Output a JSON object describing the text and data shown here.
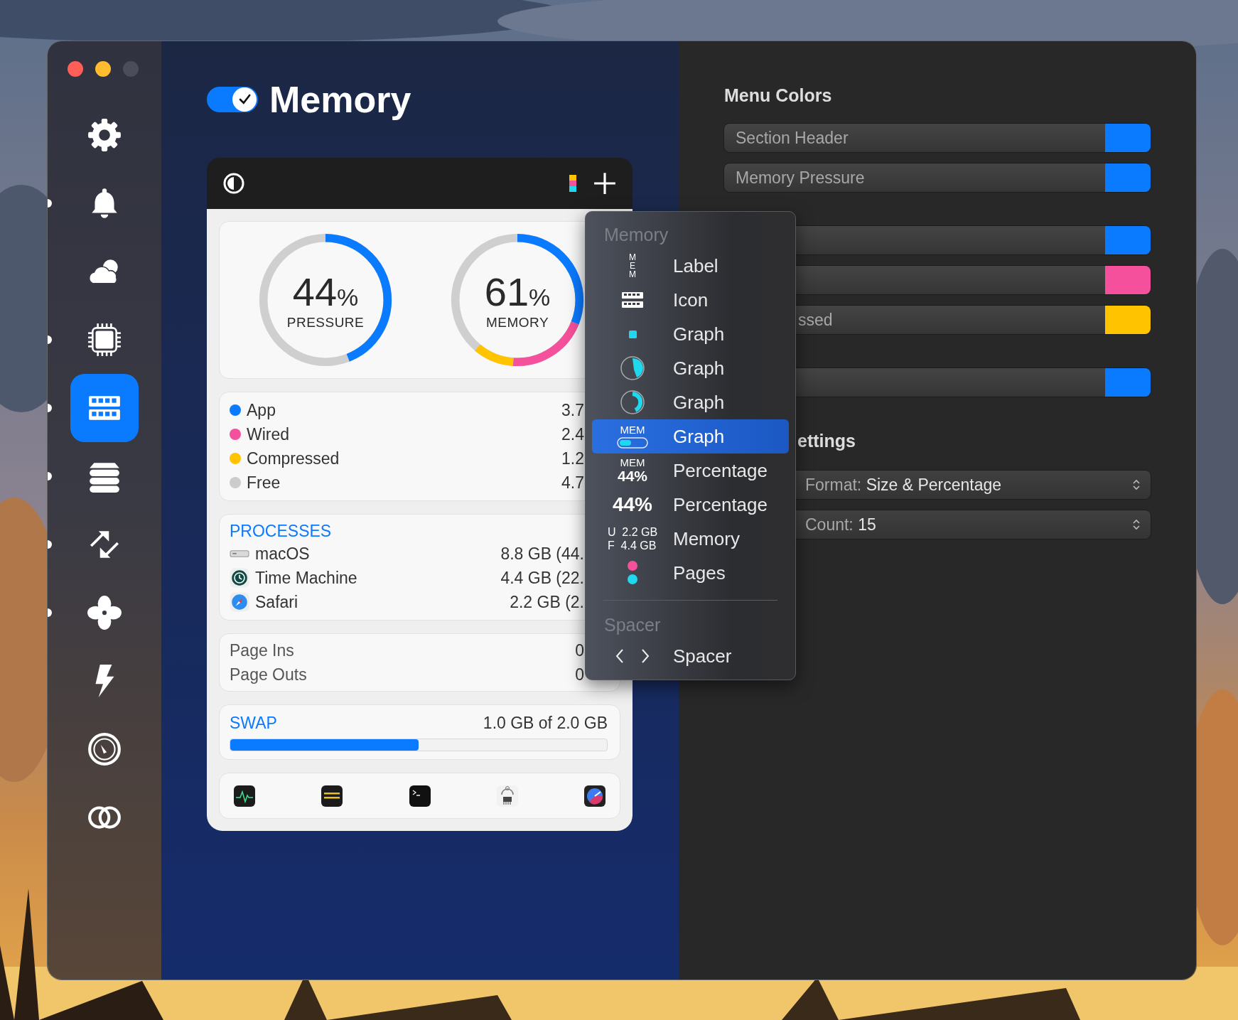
{
  "window": {
    "controls": [
      {
        "color": "#ff5f57"
      },
      {
        "color": "#febc2e"
      },
      {
        "color": "#4b4e5a"
      }
    ]
  },
  "sidebar": {
    "items": [
      {
        "kind": "gear",
        "selected": false,
        "enabled": false
      },
      {
        "kind": "bell",
        "selected": false,
        "enabled": true
      },
      {
        "kind": "cloud",
        "selected": false,
        "enabled": false
      },
      {
        "kind": "cpu",
        "selected": false,
        "enabled": true
      },
      {
        "kind": "ram",
        "selected": true,
        "enabled": true
      },
      {
        "kind": "disk",
        "selected": false,
        "enabled": true
      },
      {
        "kind": "arrows",
        "selected": false,
        "enabled": true
      },
      {
        "kind": "fan",
        "selected": false,
        "enabled": true
      },
      {
        "kind": "bolt",
        "selected": false,
        "enabled": false
      },
      {
        "kind": "clock",
        "selected": false,
        "enabled": false
      },
      {
        "kind": "rings",
        "selected": false,
        "enabled": false
      }
    ]
  },
  "header": {
    "title": "Memory",
    "on": true
  },
  "widget": {
    "gauges": [
      {
        "value": "44",
        "unit": "%",
        "caption": "PRESSURE",
        "segments": [
          {
            "color": "#0a7aff",
            "level": 0.44
          }
        ]
      },
      {
        "value": "61",
        "unit": "%",
        "caption": "MEMORY",
        "segments": [
          {
            "color": "#0a7aff",
            "level": 0.31
          },
          {
            "color": "#f5509b",
            "level": 0.2
          },
          {
            "color": "#ffc300",
            "level": 0.1
          }
        ]
      }
    ],
    "legend": [
      {
        "label": "App",
        "value": "3.7",
        "color": "#0a7aff"
      },
      {
        "label": "Wired",
        "value": "2.4",
        "color": "#f5509b"
      },
      {
        "label": "Compressed",
        "value": "1.2",
        "color": "#ffc300"
      },
      {
        "label": "Free",
        "value": "4.7",
        "color": "#cccccc"
      }
    ],
    "processes": {
      "title": "PROCESSES",
      "rows": [
        {
          "kind": "system",
          "name": "macOS",
          "value": "8.8 GB (44."
        },
        {
          "kind": "backup",
          "name": "Time Machine",
          "value": "4.4 GB (22."
        },
        {
          "kind": "browser",
          "name": "Safari",
          "value": "2.2 GB (2."
        }
      ]
    },
    "pages": [
      {
        "label": "Page Ins",
        "value": "0"
      },
      {
        "label": "Page Outs",
        "value": "0"
      }
    ],
    "swap": {
      "title": "SWAP",
      "reading": "1.0 GB of 2.0 GB",
      "level": 0.5
    },
    "apps": [
      {
        "kind": "monitor"
      },
      {
        "kind": "console"
      },
      {
        "kind": "terminal"
      },
      {
        "kind": "sysinfo"
      },
      {
        "kind": "speed"
      }
    ]
  },
  "menu": {
    "sections": [
      {
        "title": "Memory",
        "items": [
          {
            "kind": "label",
            "preview": "MEM",
            "label": "Label",
            "selected": false
          },
          {
            "kind": "icon",
            "label": "Icon",
            "selected": false
          },
          {
            "kind": "dot",
            "label": "Graph",
            "selected": false
          },
          {
            "kind": "pie",
            "label": "Graph",
            "selected": false
          },
          {
            "kind": "ring",
            "label": "Graph",
            "selected": false
          },
          {
            "kind": "bar",
            "preview": "MEM",
            "label": "Graph",
            "selected": true
          },
          {
            "kind": "stack",
            "preview_lines": [
              "MEM",
              "44%"
            ],
            "label": "Percentage",
            "selected": false
          },
          {
            "kind": "big",
            "preview": "44%",
            "label": "Percentage",
            "selected": false
          },
          {
            "kind": "memory",
            "preview_rows": [
              {
                "key": "U",
                "value": "2.2 GB"
              },
              {
                "key": "F",
                "value": "4.4 GB"
              }
            ],
            "label": "Memory",
            "selected": false
          },
          {
            "kind": "pages",
            "label": "Pages",
            "selected": false
          }
        ]
      },
      {
        "title": "Spacer",
        "items": [
          {
            "kind": "spacer",
            "label": "Spacer",
            "selected": false
          }
        ]
      }
    ]
  },
  "settings": {
    "title": "Menu Colors",
    "color_groups": [
      [
        {
          "label": "Section Header",
          "color": "#0a7aff"
        },
        {
          "label": "Memory Pressure",
          "color": "#0a7aff"
        }
      ],
      [
        {
          "color": "#0a7aff"
        },
        {
          "color": "#f5509b"
        },
        {
          "label": "ssed",
          "color": "#ffc300"
        }
      ],
      [
        {
          "color": "#0a7aff"
        }
      ]
    ],
    "section_title": "ettings",
    "selects": [
      {
        "label": "Format:",
        "value": "Size & Percentage"
      },
      {
        "label": "Count:",
        "value": "15"
      }
    ]
  }
}
